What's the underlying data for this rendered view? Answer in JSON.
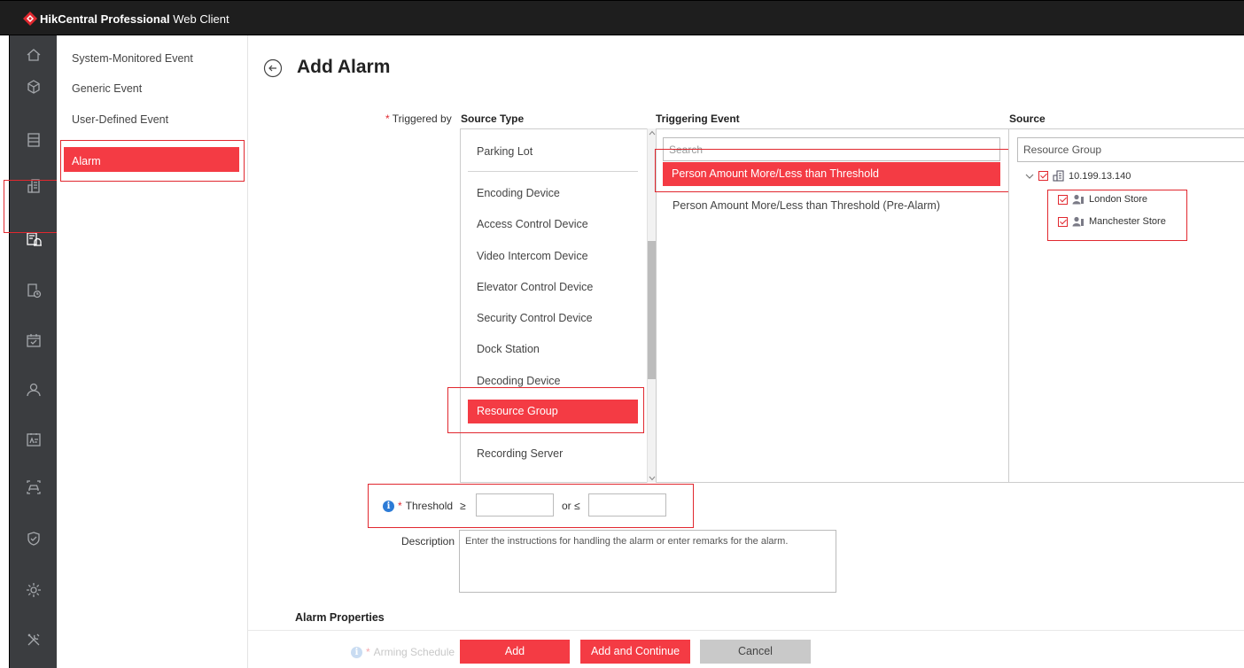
{
  "app": {
    "title_bold": "HikCentral Professional",
    "title_rest": " Web Client",
    "accent": "#f43b44"
  },
  "rail": {
    "icons": [
      "home-icon",
      "cube-icon",
      "server-icon",
      "building-icon",
      "event-alarm-icon",
      "report-icon",
      "calendar-icon",
      "person-icon",
      "id-card-icon",
      "vehicle-icon",
      "shield-icon",
      "settings-icon",
      "tools-icon"
    ],
    "active": "event-alarm-icon"
  },
  "subnav": {
    "items": [
      {
        "label": "System-Monitored Event"
      },
      {
        "label": "Generic Event"
      },
      {
        "label": "User-Defined Event"
      },
      {
        "label": "Alarm"
      }
    ]
  },
  "page": {
    "title": "Add Alarm"
  },
  "form": {
    "triggered_by_label": "Triggered by",
    "source_type_header": "Source Type",
    "triggering_event_header": "Triggering Event",
    "source_header": "Source",
    "source_types": [
      "Parking Lot",
      "Encoding Device",
      "Access Control Device",
      "Video Intercom Device",
      "Elevator Control Device",
      "Security Control Device",
      "Dock Station",
      "Decoding Device",
      "Resource Group",
      "Recording Server"
    ],
    "selected_source_type": "Resource Group",
    "event_search_placeholder": "Search",
    "events": [
      "Person Amount More/Less than Threshold",
      "Person Amount More/Less than Threshold (Pre-Alarm)"
    ],
    "selected_event": "Person Amount More/Less than Threshold",
    "source_filter_value": "Resource Group",
    "tree": {
      "root": "10.199.13.140",
      "children": [
        "London Store",
        "Manchester Store"
      ]
    },
    "threshold_label": "Threshold",
    "ge_symbol": "≥",
    "or_le": "or ≤",
    "threshold_min": "",
    "threshold_max": "",
    "description_label": "Description",
    "description_placeholder": "Enter the instructions for handling the alarm or enter remarks for the alarm.",
    "alarm_properties_header": "Alarm Properties",
    "arming_schedule_label": "Arming Schedule"
  },
  "buttons": {
    "add": "Add",
    "add_continue": "Add and Continue",
    "cancel": "Cancel"
  }
}
